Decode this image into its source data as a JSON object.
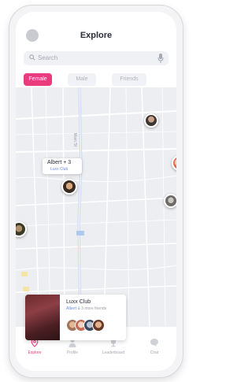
{
  "header": {
    "title": "Explore",
    "search_placeholder": "Search"
  },
  "tabs": [
    {
      "label": "Female",
      "active": true
    },
    {
      "label": "Male",
      "active": false
    },
    {
      "label": "Friends",
      "active": false
    }
  ],
  "map": {
    "road_label": "Main St",
    "callout": {
      "name": "Albert + 3",
      "sub": "Luxx Club"
    }
  },
  "venue_card": {
    "title": "Luxx Club",
    "sub_highlight": "Albert",
    "sub_rest": "& 3 more friends"
  },
  "nav": [
    {
      "label": "Explore",
      "icon": "location-pin-icon",
      "active": true
    },
    {
      "label": "Profile",
      "icon": "person-icon",
      "active": false
    },
    {
      "label": "Leaderboard",
      "icon": "trophy-icon",
      "active": false
    },
    {
      "label": "Chat",
      "icon": "chat-bubble-icon",
      "active": false
    }
  ],
  "colors": {
    "accent": "#ea3b7e",
    "link": "#6d8fd7",
    "map_background": "#eceef1"
  }
}
